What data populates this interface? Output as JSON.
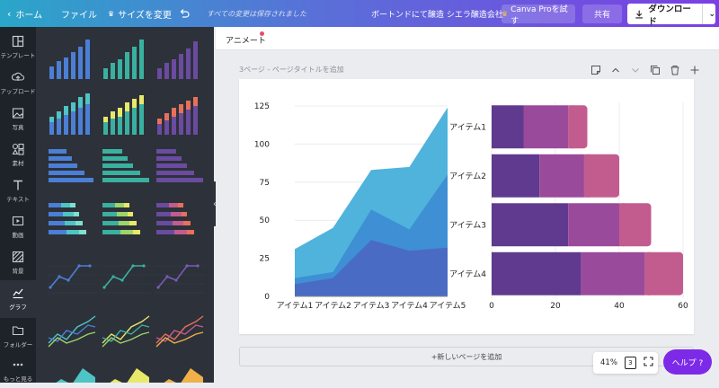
{
  "topbar": {
    "home_label": "ホーム",
    "file_label": "ファイル",
    "resize_label": "サイズを変更",
    "save_status": "すべての変更は保存されました",
    "doc_title": "ボートンドにて醸造 シエラ醸造会社",
    "try_pro_label": "Canva Proを試す",
    "share_label": "共有",
    "download_label": "ダウンロード"
  },
  "sidebar": {
    "items": [
      {
        "label": "テンプレート",
        "icon": "template-icon"
      },
      {
        "label": "アップロード",
        "icon": "upload-icon"
      },
      {
        "label": "写真",
        "icon": "photo-icon"
      },
      {
        "label": "素材",
        "icon": "elements-icon"
      },
      {
        "label": "テキスト",
        "icon": "text-icon"
      },
      {
        "label": "動画",
        "icon": "video-icon"
      },
      {
        "label": "背景",
        "icon": "background-icon"
      },
      {
        "label": "グラフ",
        "icon": "chart-icon",
        "active": true
      },
      {
        "label": "フォルダー",
        "icon": "folder-icon"
      },
      {
        "label": "もっと見る",
        "icon": "more-icon"
      }
    ]
  },
  "editor": {
    "animate_label": "アニメート",
    "page_label": "3ページ - ページタイトルを追加",
    "add_page_label": "+新しいページを追加",
    "zoom_label": "41%",
    "page_count": "3",
    "help_label": "ヘルプ ?"
  },
  "colors": {
    "accent": "#7d2ae8",
    "area1": "#4fb3dc",
    "area2": "#3f8fd4",
    "area3": "#4a6bc4",
    "bar1": "#5f3a8f",
    "bar2": "#9a4a9a",
    "bar3": "#c25c8e"
  },
  "chart_data": [
    {
      "type": "area",
      "categories": [
        "アイテム1",
        "アイテム2",
        "アイテム3",
        "アイテム4",
        "アイテム5"
      ],
      "series": [
        {
          "values": [
            31,
            45,
            83,
            85,
            124
          ]
        },
        {
          "values": [
            12,
            16,
            57,
            44,
            80
          ]
        },
        {
          "values": [
            8,
            12,
            37,
            30,
            32
          ]
        }
      ],
      "yticks": [
        "0",
        "25",
        "50",
        "75",
        "100",
        "125"
      ],
      "ylim": [
        0,
        125
      ]
    },
    {
      "type": "bar",
      "orientation": "horizontal",
      "stacked": true,
      "categories": [
        "アイテム1",
        "アイテム2",
        "アイテム3",
        "アイテム4"
      ],
      "series": [
        {
          "values": [
            10,
            15,
            24,
            28
          ]
        },
        {
          "values": [
            14,
            14,
            16,
            20
          ]
        },
        {
          "values": [
            6,
            11,
            10,
            12
          ]
        }
      ],
      "xticks": [
        "0",
        "20",
        "40",
        "60"
      ],
      "xlim": [
        0,
        60
      ]
    }
  ]
}
